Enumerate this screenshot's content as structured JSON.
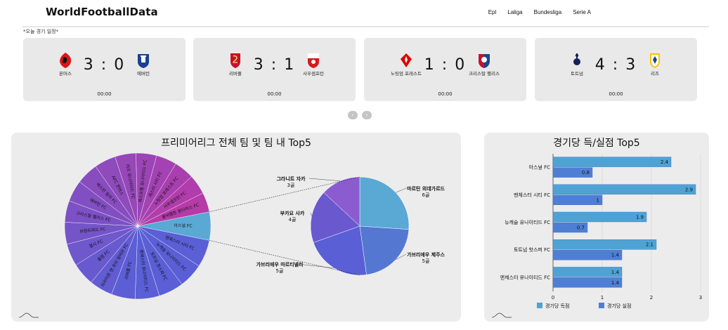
{
  "header": {
    "brand": "WorldFootballData",
    "nav": [
      "Epl",
      "Laliga",
      "Bundesliga",
      "Serie A"
    ]
  },
  "today_label": "*오늘 경기 일정*",
  "matches": [
    {
      "home": "본머스",
      "away": "에버턴",
      "score": "3 : 0",
      "time": "00:00",
      "home_icon": "bournemouth-crest",
      "away_icon": "everton-crest"
    },
    {
      "home": "리버풀",
      "away": "사우샘프턴",
      "score": "3 : 1",
      "time": "00:00",
      "home_icon": "liverpool-crest",
      "away_icon": "southampton-crest"
    },
    {
      "home": "노팅엄 포레스트",
      "away": "크리스탈 팰리스",
      "score": "1 : 0",
      "time": "00:00",
      "home_icon": "nottingham-crest",
      "away_icon": "crystal-palace-crest"
    },
    {
      "home": "토트넘",
      "away": "리즈",
      "score": "4 : 3",
      "time": "00:00",
      "home_icon": "tottenham-crest",
      "away_icon": "leeds-crest"
    }
  ],
  "carousel": {
    "prev": "‹",
    "next": "›"
  },
  "pie_panel": {
    "title": "프리미어리그 전체 팀 및 팀 내 Top5",
    "colors": {
      "selected": "#5aa8d4",
      "team_a": "#b63aa8",
      "team_b": "#5a5fd6"
    }
  },
  "bar_panel": {
    "title": "경기당 득/실점 Top5"
  },
  "chart_data": [
    {
      "type": "pie",
      "title": "프리미어리그 전체 팀 및 팀 내 Top5",
      "labels": [
        "아스널 FC",
        "맨체스터 시티 FC",
        "뉴캐슬 유나이티드 FC",
        "토트넘 핫스퍼 FC",
        "맨체스터 유나이티드 FC",
        "리버풀 FC",
        "브라이튼 앤 호브 알비온 FC",
        "풀럼 FC",
        "첼시 FC",
        "브렌트퍼드 FC",
        "크리스탈 팰리스 FC",
        "에버턴 FC",
        "애스턴 빌라 FC",
        "AFC 본머스",
        "리즈 유나이티드 FC",
        "웨스트햄 유나이티드 FC",
        "레스터 시티 FC",
        "노팅엄 포레스트 FC",
        "사우샘프턴 FC",
        "울버햄튼 원더러스 FC"
      ],
      "values": [
        6.2,
        6.0,
        5.4,
        5.5,
        5.3,
        5.2,
        5.1,
        5.0,
        4.9,
        4.8,
        4.7,
        4.7,
        4.8,
        4.7,
        4.6,
        4.5,
        4.5,
        4.4,
        4.3,
        4.3
      ]
    },
    {
      "type": "pie",
      "title": "",
      "labels": [
        "마르틴 외데가르드",
        "가브리에우 제주스",
        "가브리에우 마르티넬리",
        "부카요 사카",
        "그라니트 자카"
      ],
      "values": [
        6,
        5,
        5,
        4,
        3
      ],
      "value_labels": [
        "6골",
        "5골",
        "5골",
        "4골",
        "3골"
      ]
    },
    {
      "type": "bar",
      "orientation": "horizontal",
      "title": "경기당 득/실점 Top5",
      "categories": [
        "아스널 FC",
        "맨체스터 시티 FC",
        "뉴캐슬 유나이티드 FC",
        "토트넘 핫스퍼 FC",
        "맨체스터 유나이티드 FC"
      ],
      "series": [
        {
          "name": "경기당 득점",
          "values": [
            2.4,
            2.9,
            1.9,
            2.1,
            1.4
          ],
          "color": "#4fa3d4"
        },
        {
          "name": "경기당 실점",
          "values": [
            0.8,
            1,
            0.7,
            1.4,
            1.4
          ],
          "color": "#4f7fd4"
        }
      ],
      "xlim": [
        0,
        3
      ],
      "xticks": [
        0,
        1,
        2,
        3
      ],
      "grid": true,
      "legend": "bottom"
    }
  ]
}
